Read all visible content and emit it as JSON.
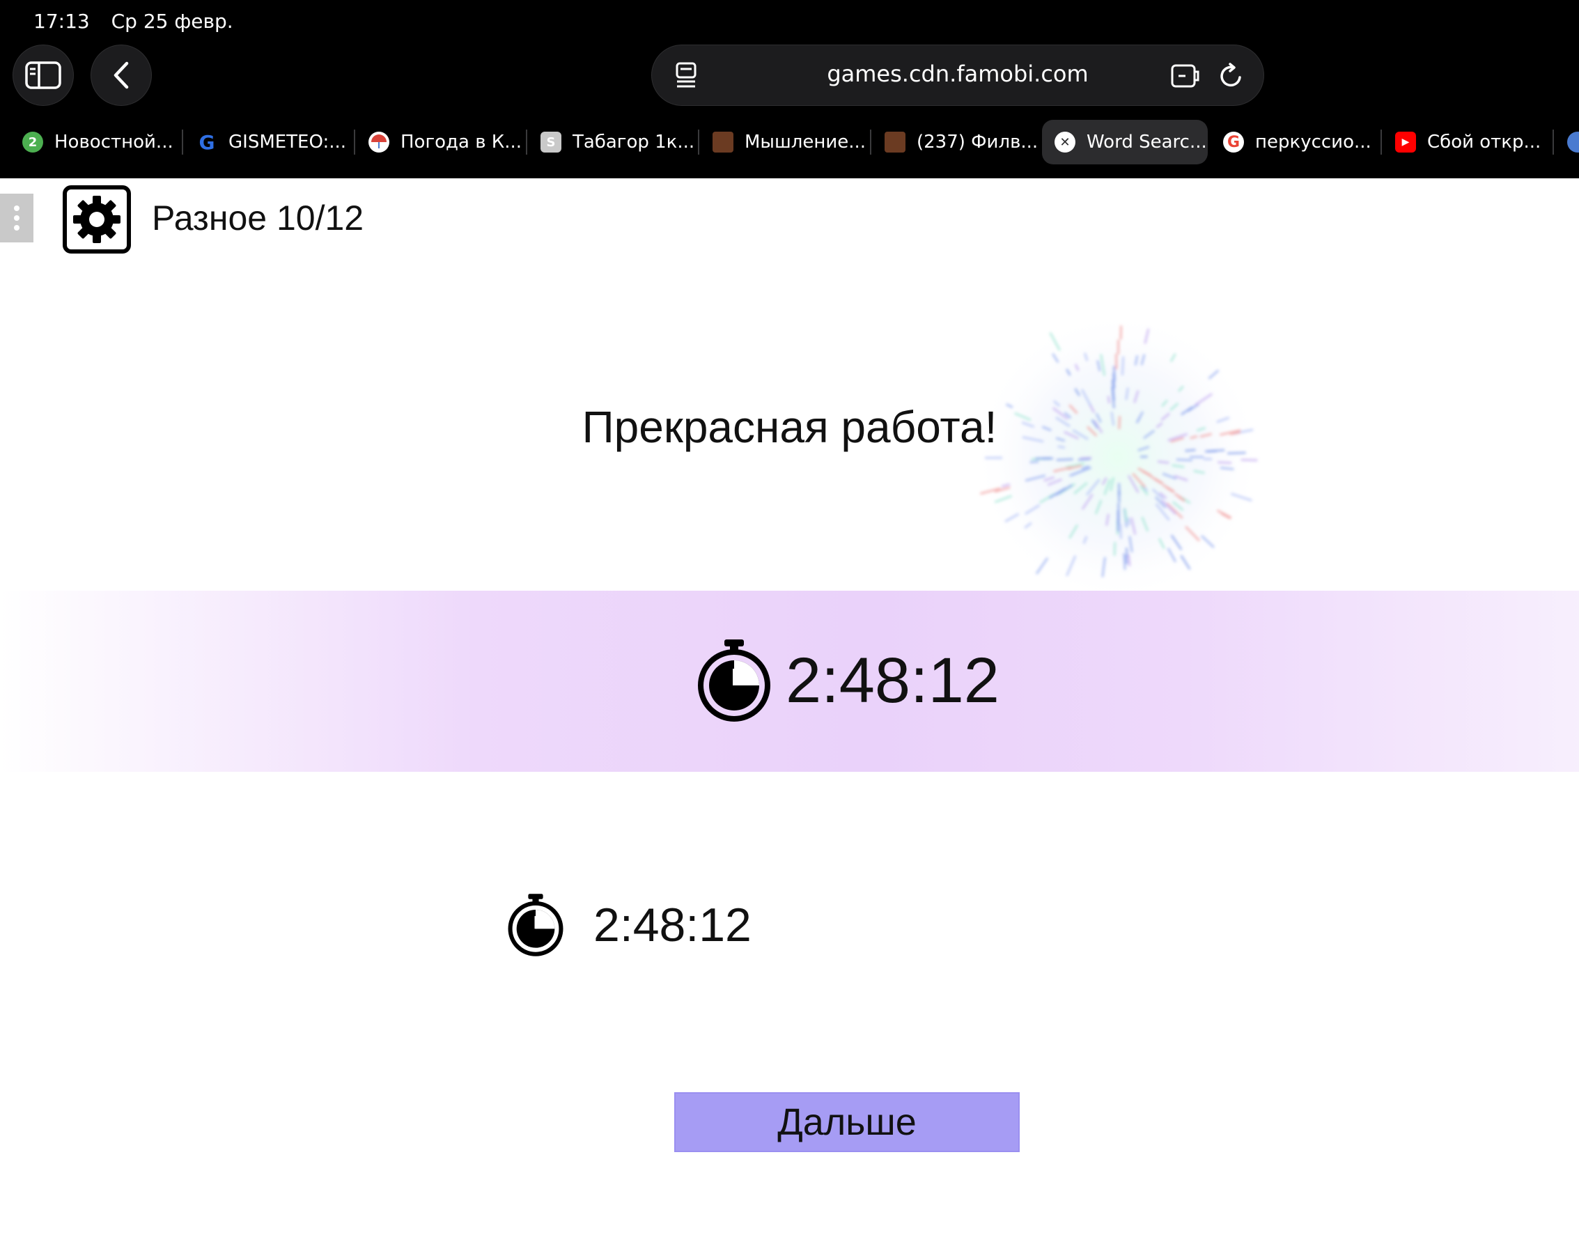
{
  "status_bar": {
    "time": "17:13",
    "date": "Ср 25 февр."
  },
  "browser": {
    "url": "games.cdn.famobi.com",
    "buttons": {
      "sidebar": "sidebar-icon",
      "back": "back-arrow-icon",
      "reader": "reader-icon",
      "extensions": "extensions-icon",
      "reload": "reload-icon"
    },
    "tabs": [
      {
        "label": "Новостной...",
        "favicon_text": "2",
        "favicon_color": "#4caf50"
      },
      {
        "label": "GISMETEO:...",
        "favicon_text": "G",
        "favicon_color": "#2f6fe4"
      },
      {
        "label": "Погода в К...",
        "favicon_text": "",
        "favicon_color": "#d9433a"
      },
      {
        "label": "Табагор 1к...",
        "favicon_text": "S",
        "favicon_color": "#c9c9c9"
      },
      {
        "label": "Мышление...",
        "favicon_text": "",
        "favicon_color": "#6b3b22"
      },
      {
        "label": "(237) Филв...",
        "favicon_text": "",
        "favicon_color": "#6b3b22"
      },
      {
        "label": "Word Searc...",
        "favicon_text": "✕",
        "favicon_color": "#ffffff",
        "active": true
      },
      {
        "label": "перкуссио...",
        "favicon_text": "G",
        "favicon_color": "#ffffff"
      },
      {
        "label": "Сбой откр...",
        "favicon_text": "▶",
        "favicon_color": "#ff0000"
      }
    ]
  },
  "game": {
    "level_label": "Разное 10/12",
    "message": "Прекрасная работа!",
    "timer_main": "2:48:12",
    "timer_best": "2:48:12",
    "next_button": "Дальше",
    "colors": {
      "band": "#eed9fb",
      "button": "#a69cf4"
    }
  }
}
